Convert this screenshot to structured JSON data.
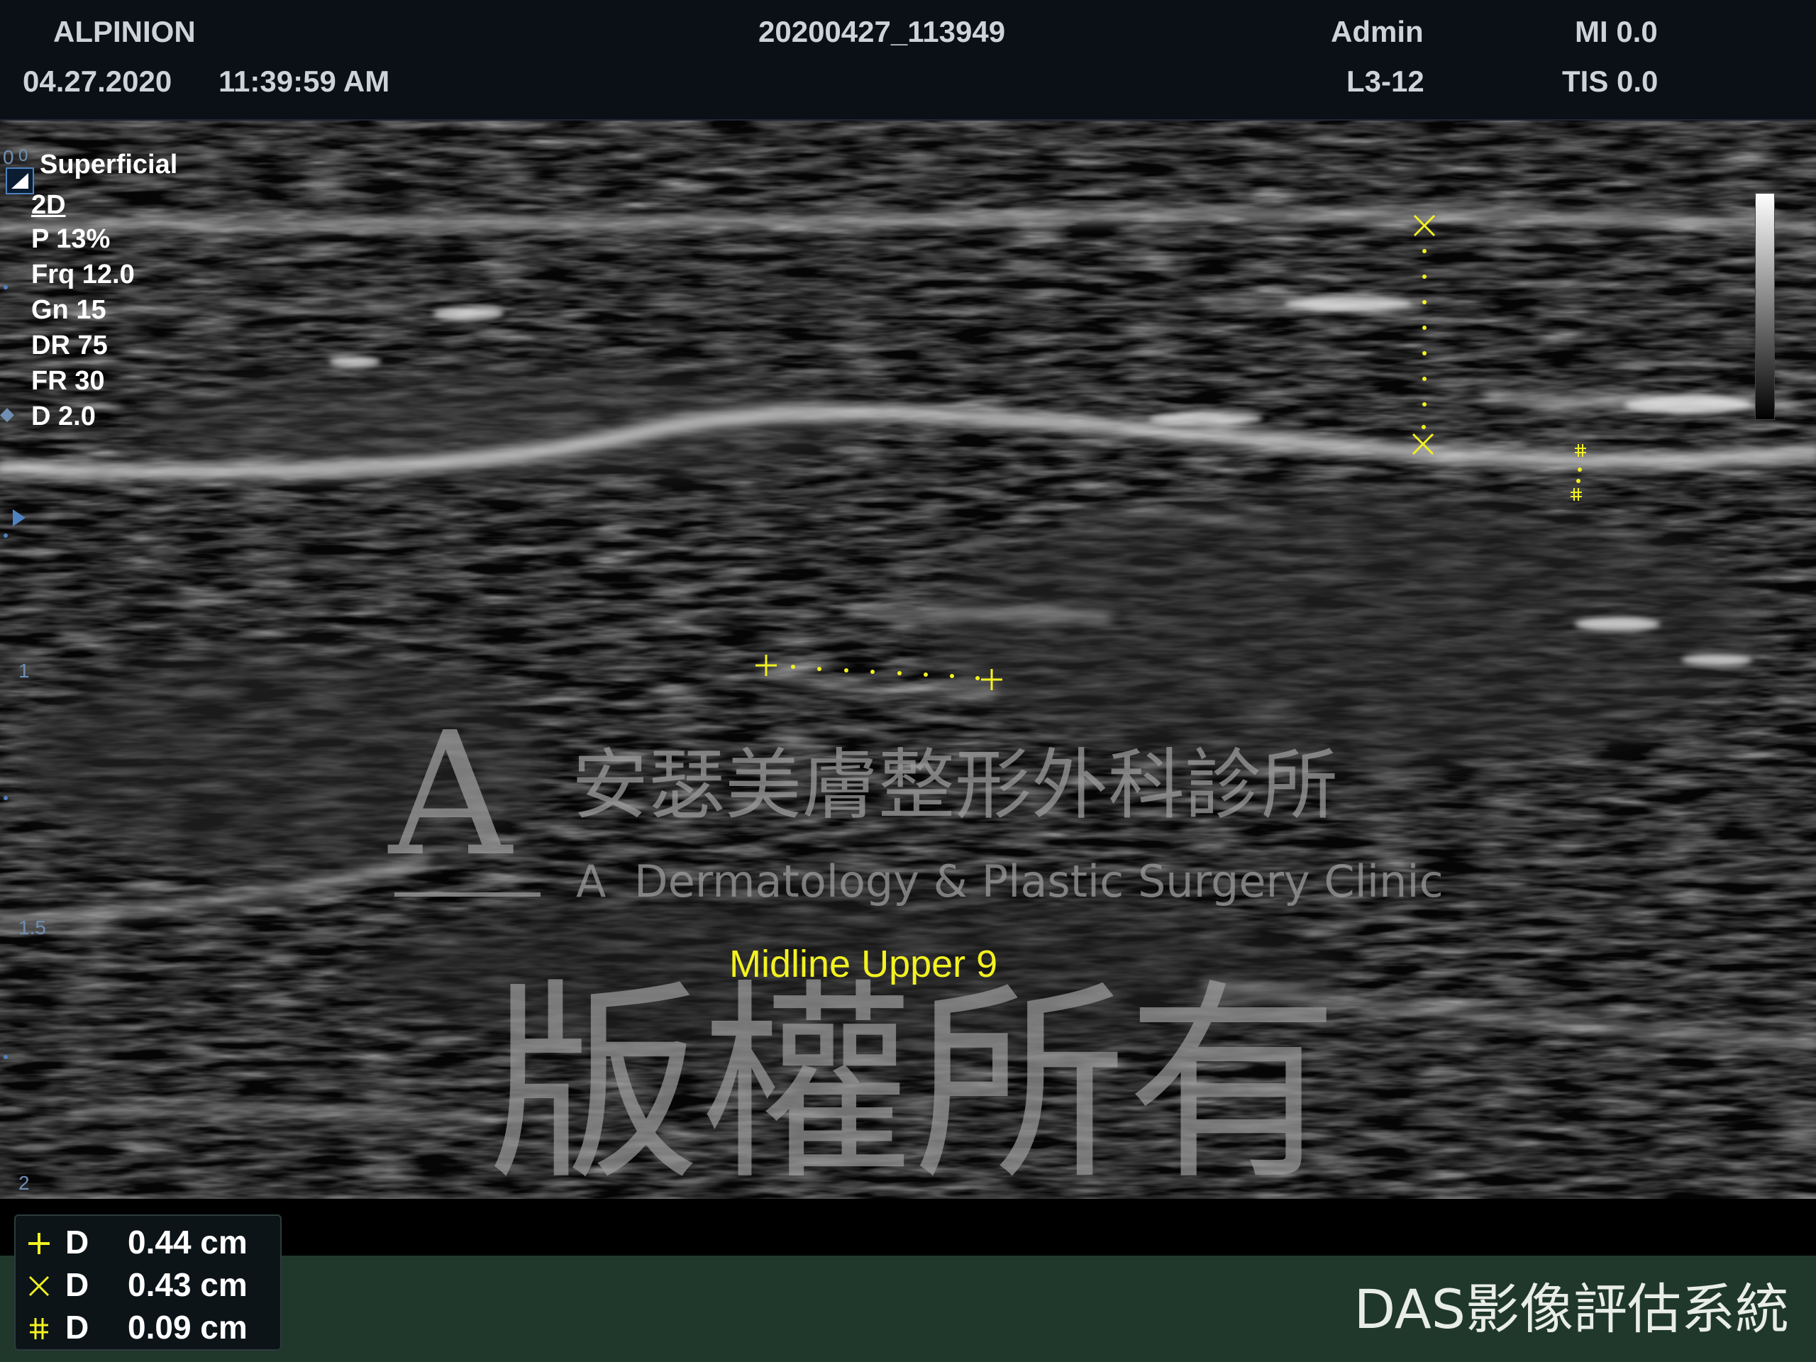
{
  "header": {
    "manufacturer": "ALPINION",
    "date": "04.27.2020",
    "time": "11:39:59 AM",
    "study_id": "20200427_113949",
    "user": "Admin",
    "probe": "L3-12",
    "mi": "MI 0.0",
    "tis": "TIS 0.0"
  },
  "params": {
    "preset": "Superficial",
    "mode": "2D",
    "power": "P 13%",
    "frequency": "Frq 12.0",
    "gain": "Gn 15",
    "dynamic_range": "DR 75",
    "frame_rate": "FR 30",
    "depth": "D 2.0"
  },
  "depth_scale": [
    "0",
    "0",
    "1",
    "1.5",
    "2"
  ],
  "annotation": "Midline Upper 9",
  "measurements": [
    {
      "symbol": "plus-icon",
      "label": "D",
      "value": "0.44 cm",
      "color": "#f3f220"
    },
    {
      "symbol": "x-icon",
      "label": "D",
      "value": "0.43 cm",
      "color": "#f3f220"
    },
    {
      "symbol": "hash-icon",
      "label": "D",
      "value": "0.09 cm",
      "color": "#f3f220"
    }
  ],
  "watermark": {
    "logo_letter": "A",
    "clinic_name_zh": "安瑟美膚整形外科診所",
    "clinic_name_en": "A  Dermatology & Plastic Surgery Clinic",
    "copyright": "版權所有"
  },
  "footer": {
    "system_name": "DAS影像評估系統"
  },
  "colors": {
    "caliper": "#f3f220",
    "footer_bg": "#20382c",
    "depth_marker": "#6f8fb4"
  }
}
